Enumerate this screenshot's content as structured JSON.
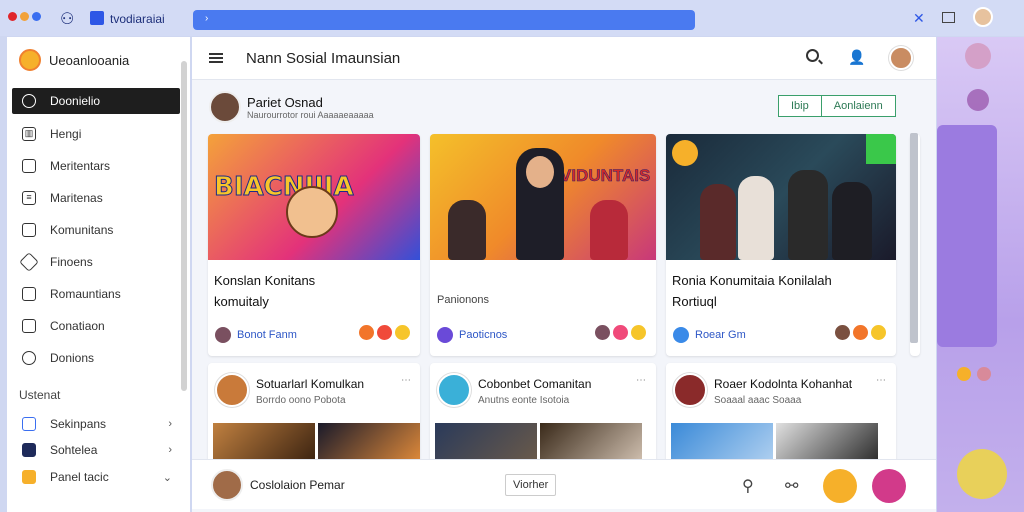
{
  "browser": {
    "tab_title": "tvodiaraiai",
    "colors": {
      "dot1": "#e0252b",
      "dot2": "#f2a23a",
      "dot3": "#3a6ef0"
    }
  },
  "sidebar": {
    "app_title": "Ueoanlooania",
    "items": [
      {
        "label": "Doonielio",
        "icon": "circle-icon",
        "active": true
      },
      {
        "label": "Hengi",
        "icon": "bar-chart-icon"
      },
      {
        "label": "Meritentars",
        "icon": "document-icon"
      },
      {
        "label": "Maritenas",
        "icon": "list-icon"
      },
      {
        "label": "Komunitans",
        "icon": "chat-icon"
      },
      {
        "label": "Finoens",
        "icon": "tag-icon"
      },
      {
        "label": "Romauntians",
        "icon": "folder-icon"
      },
      {
        "label": "Conatiaon",
        "icon": "message-icon"
      },
      {
        "label": "Donions",
        "icon": "info-icon"
      }
    ],
    "section_label": "Ustenat",
    "section_items": [
      {
        "label": "Sekinpans",
        "icon": "grid-icon"
      },
      {
        "label": "Sohtelea",
        "icon": "dark-square-icon"
      },
      {
        "label": "Panel tacic",
        "icon": "yellow-square-icon"
      }
    ]
  },
  "header": {
    "title": "Nann Sosial Imaunsian"
  },
  "post": {
    "author": "Pariet Osnad",
    "subtitle": "Naurourrotor roui Aaaaaeaaaaa",
    "btn_left": "Ibip",
    "btn_right": "Aonlaienn"
  },
  "cards": [
    {
      "title_line1": "Konslan Konitans",
      "title_line2": "komuitaly",
      "sub": "",
      "footer": "Bonot Fanm",
      "thumb_text": "BIACNIIIA"
    },
    {
      "title_line1": "",
      "title_line2": "",
      "sub": "Panionons",
      "footer": "Paoticnos",
      "thumb_text": "VIDUNTAIS"
    },
    {
      "title_line1": "Ronia Konumitaia Konilalah",
      "title_line2": "Rortiuql",
      "sub": "",
      "footer": "Roear Gm",
      "thumb_text": ""
    }
  ],
  "cards2": [
    {
      "title": "Sotuarlarl Komulkan",
      "sub": "Borrdo   oono  Pobota"
    },
    {
      "title": "Cobonbet Comanitan",
      "sub": "Anutns   eonte  Isotoia"
    },
    {
      "title": "Roaer Kodolnta Kohanhat",
      "sub": "Soaaal   aaac  Soaaa"
    }
  ],
  "bottom": {
    "user_name": "Coslolaion Pemar",
    "button": "Viorher"
  }
}
